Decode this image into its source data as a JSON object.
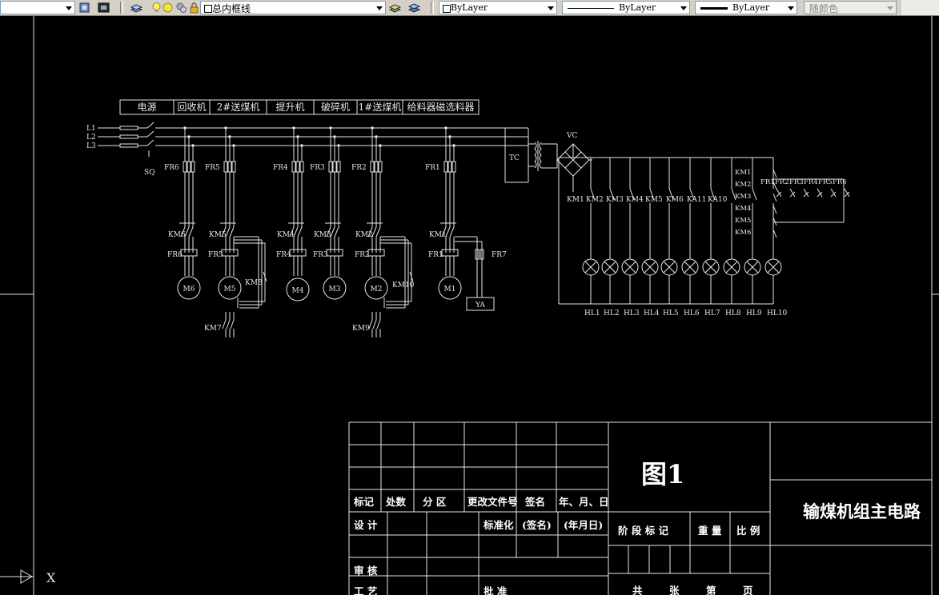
{
  "toolbar": {
    "layer_name": "总内框线",
    "color_control": "ByLayer",
    "linetype_control": "ByLayer",
    "lineweight_control": "ByLayer",
    "plotstyle_control": "随颜色"
  },
  "diagram": {
    "header_labels": [
      "电源",
      "回收机",
      "2#送煤机",
      "提升机",
      "破碎机",
      "1#送煤机",
      "给料器磁选料器"
    ],
    "lines": [
      "L1",
      "L2",
      "L3"
    ],
    "switch_label": "SQ",
    "transformer_label": "TC",
    "rectifier_label": "VC",
    "fuse_labels": [
      "FR6",
      "FR5",
      "FR4",
      "FR3",
      "FR2",
      "FR1"
    ],
    "contactor_labels": [
      "KM6",
      "KM5",
      "KM4",
      "KM3",
      "KM2",
      "KM1"
    ],
    "overload_labels": [
      "FR6",
      "FR5",
      "FR4",
      "FR3",
      "FR2",
      "FR1"
    ],
    "motor_labels": [
      "M6",
      "M5",
      "M4",
      "M3",
      "M2",
      "M1"
    ],
    "aux_contactors": [
      "KM8",
      "KM10",
      "KM7",
      "KM9"
    ],
    "fr7_label": "FR7",
    "ya_label": "YA",
    "control_km_labels": [
      "KM1",
      "KM2",
      "KM3",
      "KM4",
      "KM5",
      "KM6",
      "KA11",
      "KA10"
    ],
    "interlock_km_labels": [
      "KM1",
      "KM2",
      "KM3",
      "KM4",
      "KM5",
      "KM6"
    ],
    "fr_contacts": [
      "FR1",
      "FR2",
      "FR3",
      "FR4",
      "FR5",
      "FR6"
    ],
    "lamp_labels": [
      "HL1",
      "HL2",
      "HL3",
      "HL4",
      "HL5",
      "HL6",
      "HL7",
      "HL8",
      "HL9",
      "HL10"
    ]
  },
  "title_block": {
    "figure": "图1",
    "drawing_title": "输煤机组主电路",
    "rev_headers": [
      "标记",
      "处数",
      "分 区",
      "更改文件号",
      "签名",
      "年、月、日"
    ],
    "design": "设 计",
    "standardize": "标准化",
    "signature": "(签名)",
    "date": "(年月日)",
    "stage_mark": "阶 段 标 记",
    "weight": "重 量",
    "scale": "比 例",
    "review": "审 核",
    "process": "工 艺",
    "approve": "批 准",
    "total": "共",
    "sheets": "张",
    "number": "第",
    "page": "页"
  },
  "ucs": {
    "x_label": "X"
  }
}
